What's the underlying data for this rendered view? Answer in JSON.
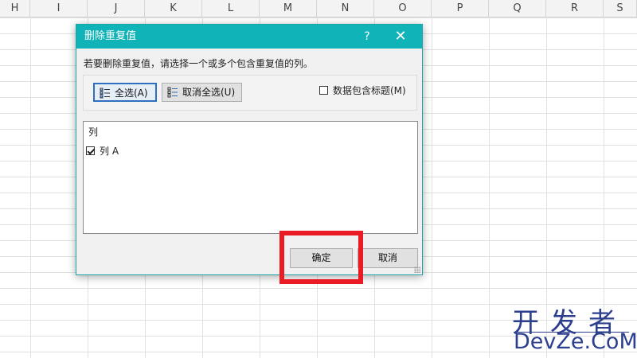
{
  "spreadsheet": {
    "columns": [
      "H",
      "I",
      "J",
      "K",
      "L",
      "M",
      "N",
      "O",
      "P",
      "Q",
      "R",
      "S"
    ]
  },
  "dialog": {
    "title": "删除重复值",
    "help_label": "?",
    "close_label": "✕",
    "instruction": "若要删除重复值，请选择一个或多个包含重复值的列。",
    "select_all_label": "全选(A)",
    "unselect_all_label": "取消全选(U)",
    "header_checkbox_label": "数据包含标题(M)",
    "header_checkbox_checked": false,
    "list_header": "列",
    "list_items": [
      {
        "label": "列 A",
        "checked": true
      }
    ],
    "ok_label": "确定",
    "cancel_label": "取消"
  },
  "watermark": {
    "cn": "开发者",
    "en": "DevZe.CoM"
  },
  "colors": {
    "titlebar": "#0fb3b8",
    "highlight": "#ea1b24",
    "watermark": "#2c3f8f"
  }
}
